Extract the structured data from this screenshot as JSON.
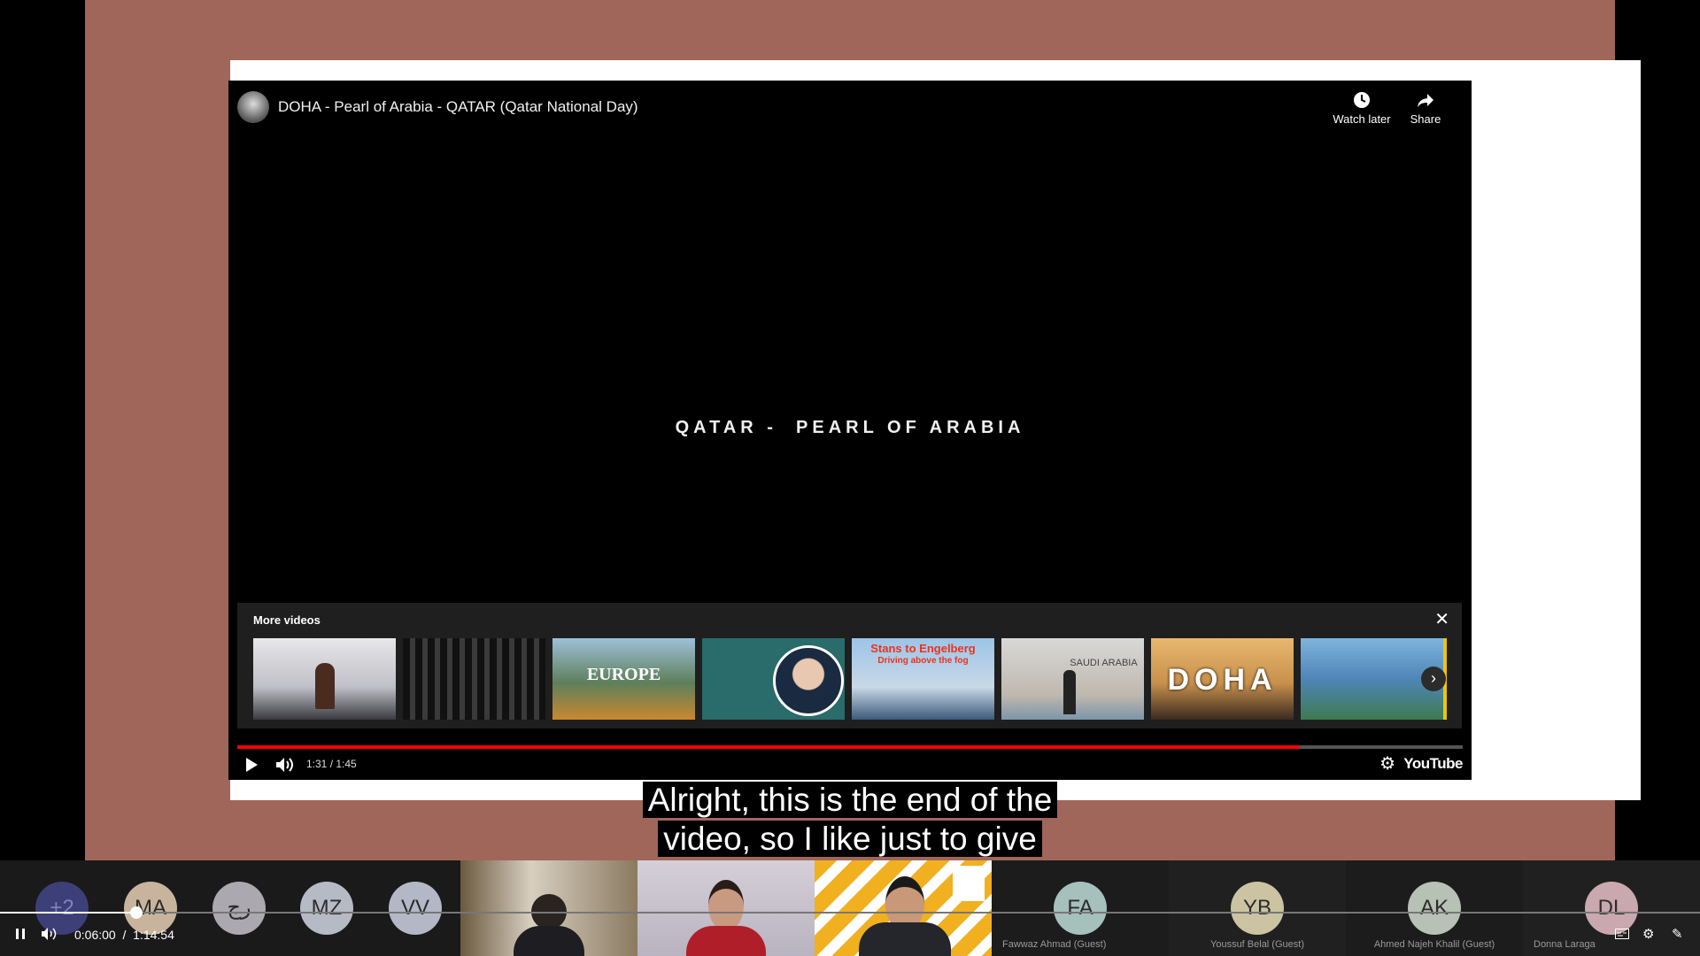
{
  "youtube": {
    "video_title": "DOHA - Pearl of Arabia - QATAR (Qatar National Day)",
    "watch_later_label": "Watch later",
    "share_label": "Share",
    "center_text": "QATAR -  PEARL OF ARABIA",
    "more_videos_label": "More videos",
    "thumbnails": [
      {
        "text": "",
        "color": "#c6c3c6"
      },
      {
        "text": "",
        "color": "#2a2a2a"
      },
      {
        "text": "EUROPE",
        "color": "#5a7f95"
      },
      {
        "text": "",
        "color": "#2f6a6a"
      },
      {
        "text": "Stans to Engelberg",
        "subtext": "Driving above the fog",
        "color": "#8fb4d8"
      },
      {
        "text": "SAUDI ARABIA",
        "color": "#d9d6d0"
      },
      {
        "text": "DOHA",
        "color": "#c89050"
      },
      {
        "text": "",
        "color": "#4e86b8"
      }
    ],
    "time": "1:31 / 1:45",
    "progress_fraction": 0.867,
    "logo_text": "YouTube"
  },
  "caption": {
    "line1": "Alright, this is the end of the",
    "line2": "video, so I like just to give"
  },
  "participants": [
    {
      "initials": "+2",
      "name": "",
      "color": "#3c3f78"
    },
    {
      "initials": "MA",
      "name": "",
      "color": "#c8b49c"
    },
    {
      "initials": "ﺭﺝ",
      "name": "",
      "color": "#aba8b0"
    },
    {
      "initials": "MZ",
      "name": "",
      "color": "#b6bac4"
    },
    {
      "initials": "VV",
      "name": "",
      "color": "#b4b8c6"
    },
    {
      "initials": "FA",
      "name": "Fawwaz Ahmad (Guest)",
      "color": "#a6c0bc"
    },
    {
      "initials": "YB",
      "name": "Youssuf Belal (Guest)",
      "color": "#cbc3a2"
    },
    {
      "initials": "AK",
      "name": "Ahmed Najeh Khalil (Guest)",
      "color": "#b7c1b5"
    },
    {
      "initials": "DL",
      "name": "Donna Laraga",
      "color": "#c9a8b0"
    }
  ],
  "player": {
    "current_time": "0:06:00",
    "separator": "/",
    "duration": "1:14:54",
    "progress_fraction": 0.08
  }
}
